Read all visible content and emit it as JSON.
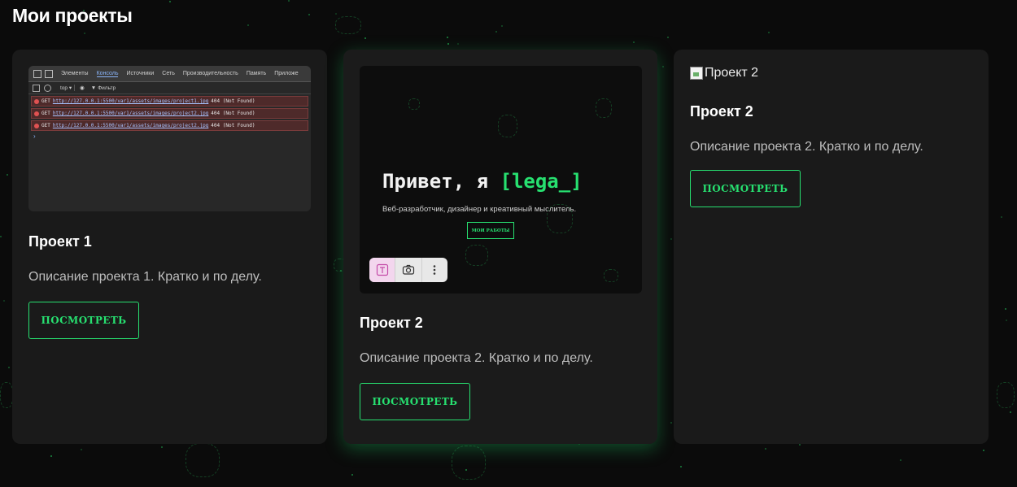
{
  "page": {
    "title": "Мои проекты"
  },
  "colors": {
    "accent": "#27e070",
    "background": "#0b0b0b",
    "card": "#1a1a1a"
  },
  "projects": [
    {
      "title": "Проект 1",
      "description": "Описание проекта 1. Кратко и по делу.",
      "button": "ПОСМОТРЕТЬ",
      "screenshot": {
        "tabs": [
          "Элементы",
          "Консоль",
          "Источники",
          "Сеть",
          "Производительность",
          "Память",
          "Приложе"
        ],
        "active_tab": "Консоль",
        "context": "top ▾",
        "filter": "Фильтр",
        "errors": [
          {
            "method": "GET",
            "url": "http://127.0.0.1:5500/var1/assets/images/project1.jpg",
            "status": "404 (Not Found)"
          },
          {
            "method": "GET",
            "url": "http://127.0.0.1:5500/var1/assets/images/project2.jpg",
            "status": "404 (Not Found)"
          },
          {
            "method": "GET",
            "url": "http://127.0.0.1:5500/var1/assets/images/project2.jpg",
            "status": "404 (Not Found)"
          }
        ],
        "prompt": "›"
      }
    },
    {
      "title": "Проект 2",
      "description": "Описание проекта 2. Кратко и по делу.",
      "button": "ПОСМОТРЕТЬ",
      "screenshot": {
        "heading_prefix": "Привет, я ",
        "heading_accent": "[lega_]",
        "subtitle": "Веб-разработчик, дизайнер и креативный мыслитель.",
        "button": "МОИ РАБОТЫ",
        "tools": [
          "text-recognition-icon",
          "camera-icon",
          "more-vertical-icon"
        ]
      }
    },
    {
      "title": "Проект 2",
      "description": "Описание проекта 2. Кратко и по делу.",
      "button": "ПОСМОТРЕТЬ",
      "image_alt": "Проект 2"
    }
  ]
}
